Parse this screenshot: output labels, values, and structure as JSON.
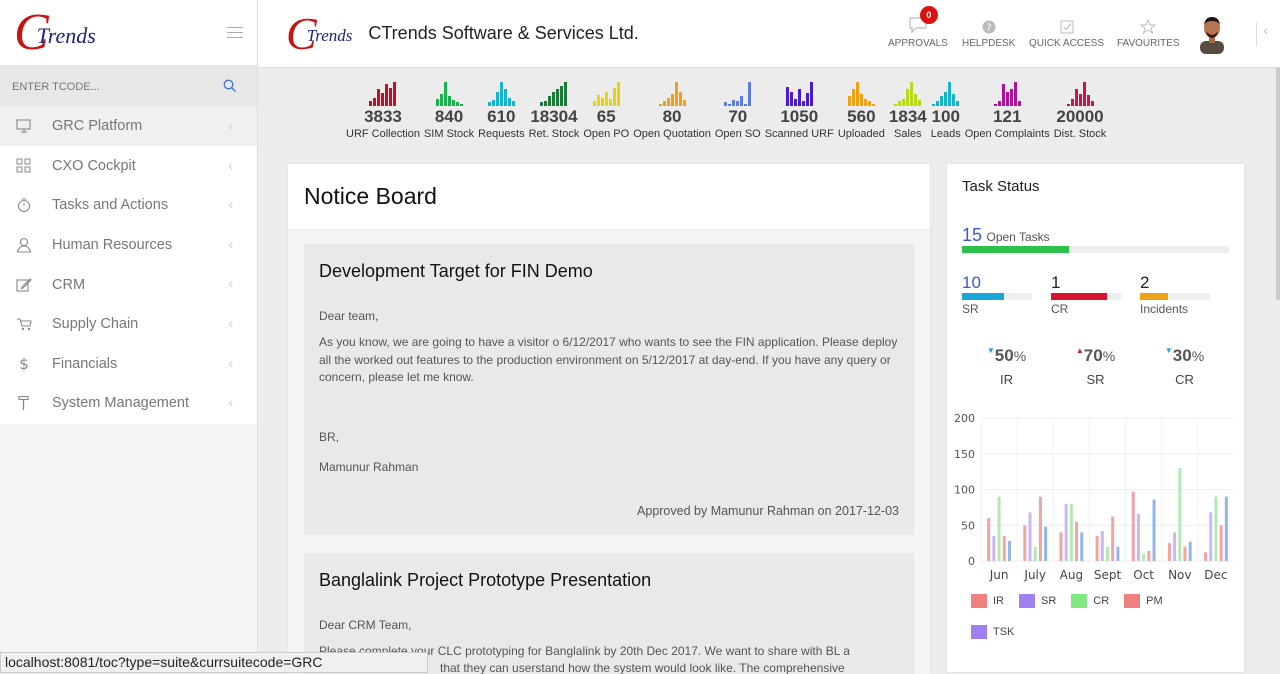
{
  "brand": {
    "letter": "C",
    "text": "Trends",
    "color": "#c91212"
  },
  "tcode": {
    "placeholder": "ENTER TCODE..."
  },
  "sidebar": {
    "items": [
      {
        "label": "GRC Platform",
        "icon": "monitor-icon"
      },
      {
        "label": "CXO Cockpit",
        "icon": "grid-icon"
      },
      {
        "label": "Tasks and Actions",
        "icon": "stopwatch-icon"
      },
      {
        "label": "Human Resources",
        "icon": "user-icon"
      },
      {
        "label": "CRM",
        "icon": "edit-icon"
      },
      {
        "label": "Supply Chain",
        "icon": "cart-icon"
      },
      {
        "label": "Financials",
        "icon": "dollar-icon"
      },
      {
        "label": "System Management",
        "icon": "hammer-icon"
      }
    ]
  },
  "header": {
    "company": "CTrends Software & Services Ltd.",
    "approvals_count": "0",
    "nav": [
      {
        "label": "APPROVALS",
        "icon": "chat-icon"
      },
      {
        "label": "HELPDESK",
        "icon": "help-icon"
      },
      {
        "label": "QUICK ACCESS",
        "icon": "checkbox-icon"
      },
      {
        "label": "FAVOURITES",
        "icon": "star-icon"
      }
    ]
  },
  "stats": [
    {
      "value": "3833",
      "label": "URF Collection",
      "color": "#c0102a",
      "bars": [
        0.2,
        0.35,
        0.7,
        0.55,
        0.9,
        0.75,
        1
      ]
    },
    {
      "value": "840",
      "label": "SIM Stock",
      "color": "#1ab24a",
      "bars": [
        0.3,
        0.5,
        1,
        0.4,
        0.25,
        0.15,
        0.1
      ]
    },
    {
      "value": "610",
      "label": "Requests",
      "color": "#17b3cc",
      "bars": [
        0.15,
        0.25,
        0.6,
        1,
        0.7,
        0.35,
        0.2
      ]
    },
    {
      "value": "18304",
      "label": "Ret. Stock",
      "color": "#1d7a3a",
      "bars": [
        0.15,
        0.2,
        0.4,
        0.6,
        0.7,
        0.85,
        1
      ]
    },
    {
      "value": "65",
      "label": "Open PO",
      "color": "#e8d40a",
      "bars": [
        0.2,
        0.45,
        0.35,
        0.6,
        0.3,
        0.75,
        1
      ]
    },
    {
      "value": "80",
      "label": "Open Quotation",
      "color": "#f0a012",
      "bars": [
        0.1,
        0.2,
        0.35,
        0.5,
        1,
        0.6,
        0.25
      ]
    },
    {
      "value": "70",
      "label": "Open SO",
      "color": "#5a7ee0",
      "bars": [
        0.15,
        0.1,
        0.25,
        0.2,
        0.4,
        0.1,
        1
      ]
    },
    {
      "value": "1050",
      "label": "Scanned URF",
      "color": "#4a1ad0",
      "bars": [
        0.8,
        0.6,
        0.3,
        0.7,
        0.2,
        0.55,
        1
      ]
    },
    {
      "value": "560",
      "label": "Uploaded",
      "color": "#f0a012",
      "bars": [
        0.4,
        0.7,
        1,
        0.5,
        0.3,
        0.2,
        0.1
      ]
    },
    {
      "value": "1834",
      "label": "Sales",
      "color": "#b8d81a",
      "bars": [
        0.1,
        0.2,
        0.3,
        0.7,
        1,
        0.5,
        0.25
      ]
    },
    {
      "value": "100",
      "label": "Leads",
      "color": "#17b3cc",
      "bars": [
        0.1,
        0.2,
        0.4,
        0.6,
        1,
        0.5,
        0.2
      ]
    },
    {
      "value": "121",
      "label": "Open Complaints",
      "color": "#b010a0",
      "bars": [
        0.1,
        0.2,
        0.9,
        0.6,
        0.7,
        1,
        0.2
      ]
    },
    {
      "value": "20000",
      "label": "Dist. Stock",
      "color": "#d0104a",
      "bars": [
        0.1,
        0.3,
        0.7,
        0.5,
        1,
        0.45,
        0.2
      ]
    }
  ],
  "notice": {
    "title": "Notice Board",
    "items": [
      {
        "title": "Development Target for FIN Demo",
        "paragraphs": [
          "Dear team,",
          "As you know, we are going to have a visitor o 6/12/2017 who wants to see the FIN application. Please deploy all the worked out features to the production environment on 5/12/2017 at day-end. If you have any query or concern, please let me know.",
          "BR,",
          "Mamunur Rahman"
        ],
        "approval": "Approved by Mamunur Rahman on 2017-12-03"
      },
      {
        "title": "Banglalink Project Prototype Presentation",
        "paragraphs": [
          "Dear CRM Team,",
          "Please complete your CLC prototyping for Banglalink by 20th Dec 2017. We want to share with BL a",
          "that they can userstand how the system would look like. The comprehensive"
        ]
      }
    ]
  },
  "task": {
    "title": "Task Status",
    "open": {
      "count": "15",
      "label": "Open Tasks",
      "fraction": 0.4,
      "color": "#2ec14a"
    },
    "breakdown": [
      {
        "count": "10",
        "label": "SR",
        "fraction": 0.6,
        "color": "#17a8d8",
        "num_color": "#3d58d4"
      },
      {
        "count": "1",
        "label": "CR",
        "fraction": 0.8,
        "color": "#d8132e",
        "num_color": "#222"
      },
      {
        "count": "2",
        "label": "Incidents",
        "fraction": 0.4,
        "color": "#f0a012",
        "num_color": "#222"
      }
    ],
    "percents": [
      {
        "value": "50",
        "unit": "%",
        "label": "IR",
        "dir": "down",
        "arrow_color": "#17a8d8"
      },
      {
        "value": "70",
        "unit": "%",
        "label": "SR",
        "dir": "up",
        "arrow_color": "#d8132e"
      },
      {
        "value": "30",
        "unit": "%",
        "label": "CR",
        "dir": "down",
        "arrow_color": "#17a8d8"
      }
    ]
  },
  "chart_data": {
    "type": "bar",
    "categories": [
      "Jun",
      "July",
      "Aug",
      "Sept",
      "Oct",
      "Nov",
      "Dec"
    ],
    "ylim": [
      0,
      200
    ],
    "yticks": [
      0,
      50,
      100,
      150,
      200
    ],
    "series": [
      {
        "name": "IR",
        "color": "#f4a3a3",
        "values": [
          60,
          50,
          40,
          35,
          97,
          25,
          12
        ]
      },
      {
        "name": "SR",
        "color": "#c9b8f4",
        "values": [
          35,
          68,
          80,
          42,
          66,
          40,
          68
        ]
      },
      {
        "name": "CR",
        "color": "#b4e8b4",
        "values": [
          90,
          20,
          80,
          20,
          10,
          130,
          90
        ]
      },
      {
        "name": "PM",
        "color": "#f4a3a3",
        "values": [
          35,
          90,
          55,
          62,
          14,
          20,
          50
        ]
      },
      {
        "name": "TSK",
        "color": "#93b6e8",
        "values": [
          28,
          48,
          40,
          20,
          86,
          27,
          90
        ]
      }
    ],
    "legend_colors": [
      "#f08080",
      "#a080f0",
      "#80e880",
      "#f08080",
      "#a080f0"
    ]
  },
  "statusbar": {
    "url": "localhost:8081/toc?type=suite&currsuitecode=GRC"
  }
}
